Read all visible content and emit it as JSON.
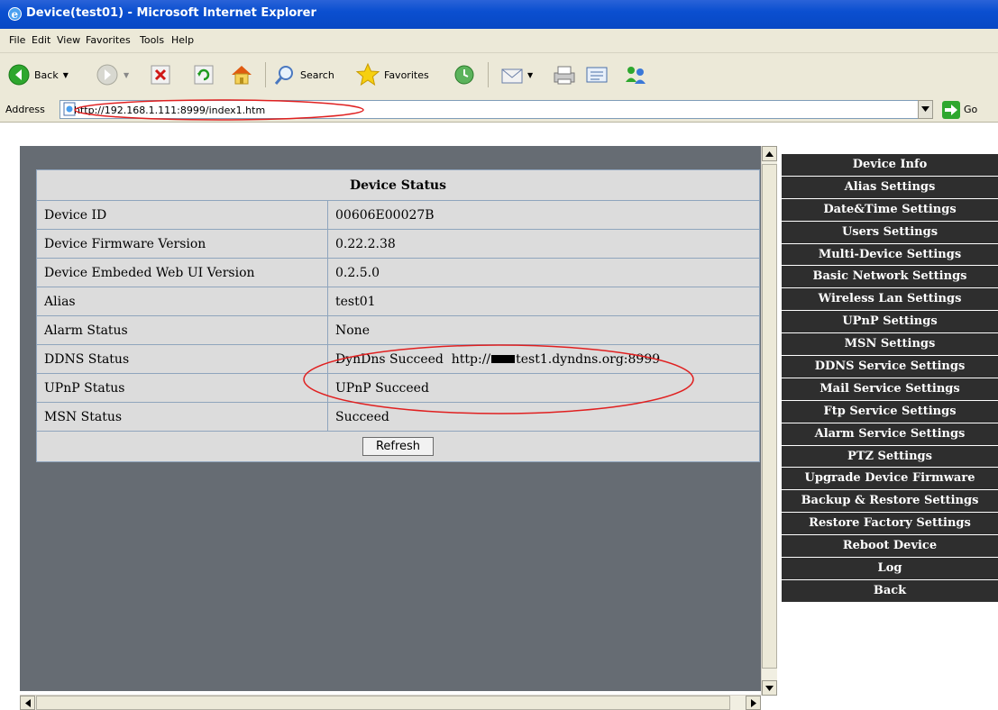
{
  "window": {
    "title": "Device(test01) - Microsoft Internet Explorer"
  },
  "menu": [
    "File",
    "Edit",
    "View",
    "Favorites",
    "Tools",
    "Help"
  ],
  "toolbar": {
    "back_label": "Back",
    "search_label": "Search",
    "favorites_label": "Favorites"
  },
  "address": {
    "label": "Address",
    "url": "http://192.168.1.111:8999/index1.htm",
    "go_label": "Go"
  },
  "status": {
    "title": "Device Status",
    "rows": [
      {
        "label": "Device ID",
        "value": "00606E00027B"
      },
      {
        "label": "Device Firmware Version",
        "value": "0.22.2.38"
      },
      {
        "label": "Device Embeded Web UI Version",
        "value": "0.2.5.0"
      },
      {
        "label": "Alias",
        "value": "test01"
      },
      {
        "label": "Alarm Status",
        "value": "None"
      },
      {
        "label": "DDNS Status",
        "value_prefix": "DynDns Succeed  http://",
        "value_suffix": "test1.dyndns.org:8999"
      },
      {
        "label": "UPnP Status",
        "value": "UPnP Succeed"
      },
      {
        "label": "MSN Status",
        "value": "Succeed"
      }
    ],
    "refresh_label": "Refresh"
  },
  "side_menu": [
    "Device Info",
    "Alias Settings",
    "Date&Time Settings",
    "Users Settings",
    "Multi-Device Settings",
    "Basic Network Settings",
    "Wireless Lan Settings",
    "UPnP Settings",
    "MSN Settings",
    "DDNS Service Settings",
    "Mail Service Settings",
    "Ftp Service Settings",
    "Alarm Service Settings",
    "PTZ Settings",
    "Upgrade Device Firmware",
    "Backup & Restore Settings",
    "Restore Factory Settings",
    "Reboot Device",
    "Log",
    "Back"
  ],
  "colors": {
    "titlebar": "#0a4fd0",
    "chrome": "#ece9d8",
    "frame_bg": "#666c73",
    "table_bg": "#dcdcdc",
    "side_menu_bg": "#2e2e2e",
    "annotation": "#e02020"
  }
}
